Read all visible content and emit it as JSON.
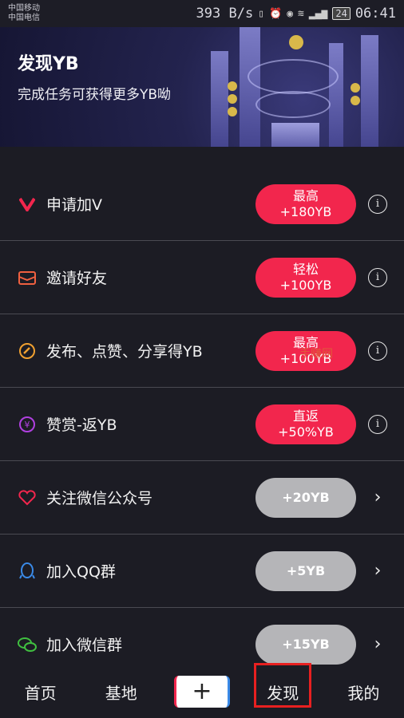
{
  "status": {
    "carrier1": "中国移动",
    "carrier2": "中国电信",
    "speed": "393 B/s",
    "battery": "24",
    "time": "06:41"
  },
  "banner": {
    "title": "发现YB",
    "subtitle": "完成任务可获得更多YB呦"
  },
  "rows": [
    {
      "label": "申请加V",
      "pill1": "最高",
      "pill2": "+180YB",
      "icon": "v-icon",
      "style": "red",
      "trail": "info"
    },
    {
      "label": "邀请好友",
      "pill1": "轻松",
      "pill2": "+100YB",
      "icon": "envelope-icon",
      "style": "red",
      "trail": "info"
    },
    {
      "label": "发布、点赞、分享得YB",
      "pill1": "最高",
      "pill2": "+100YB",
      "icon": "circle-arrow-icon",
      "style": "red",
      "trail": "info"
    },
    {
      "label": "赞赏-返YB",
      "pill1": "直返",
      "pill2": "+50%YB",
      "icon": "yen-coin-icon",
      "style": "red",
      "trail": "info"
    },
    {
      "label": "关注微信公众号",
      "pill1": "",
      "pill2": "+20YB",
      "icon": "heart-icon",
      "style": "gray",
      "trail": "chevron"
    },
    {
      "label": "加入QQ群",
      "pill1": "",
      "pill2": "+5YB",
      "icon": "qq-icon",
      "style": "gray",
      "trail": "chevron"
    },
    {
      "label": "加入微信群",
      "pill1": "",
      "pill2": "+15YB",
      "icon": "wechat-icon",
      "style": "gray",
      "trail": "chevron"
    }
  ],
  "watermark": "手赚网",
  "tabs": {
    "home": "首页",
    "base": "基地",
    "plus": "+",
    "discover": "发现",
    "mine": "我的"
  }
}
